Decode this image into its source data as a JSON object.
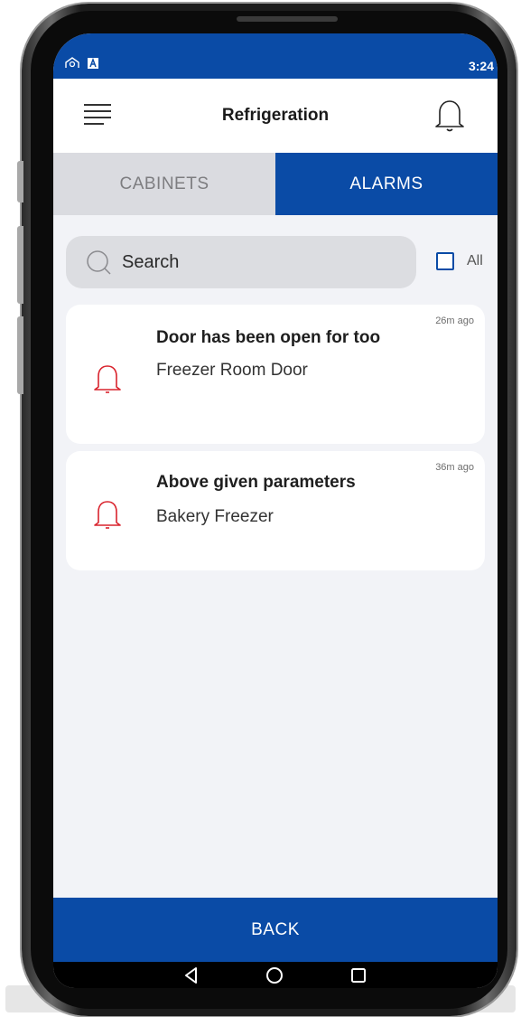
{
  "status_bar": {
    "time": "3:24",
    "icons": [
      "notification-app-icon",
      "a-badge-icon"
    ]
  },
  "header": {
    "title": "Refrigeration",
    "left_icon": "menu-icon",
    "right_icon": "bell-icon"
  },
  "tabs": [
    {
      "label": "CABINETS",
      "active": false
    },
    {
      "label": "ALARMS",
      "active": true
    }
  ],
  "search": {
    "placeholder": "Search",
    "icon": "search-icon"
  },
  "select_all": {
    "label": "All",
    "checked": false
  },
  "alarms": [
    {
      "title": "Door has been open for too",
      "subtitle": "Freezer Room Door",
      "time": "26m ago",
      "icon": "bell-icon"
    },
    {
      "title": "Above given parameters",
      "subtitle": "Bakery Freezer",
      "time": "36m ago",
      "icon": "bell-icon"
    }
  ],
  "footer": {
    "back_label": "BACK"
  },
  "nav_bar": {
    "buttons": [
      "back-triangle-icon",
      "home-circle-icon",
      "recents-square-icon"
    ]
  },
  "colors": {
    "accent": "#0a4ba6",
    "alarm_icon": "#d9232d",
    "background": "#f2f3f7",
    "tab_inactive": "#dadbe0"
  }
}
